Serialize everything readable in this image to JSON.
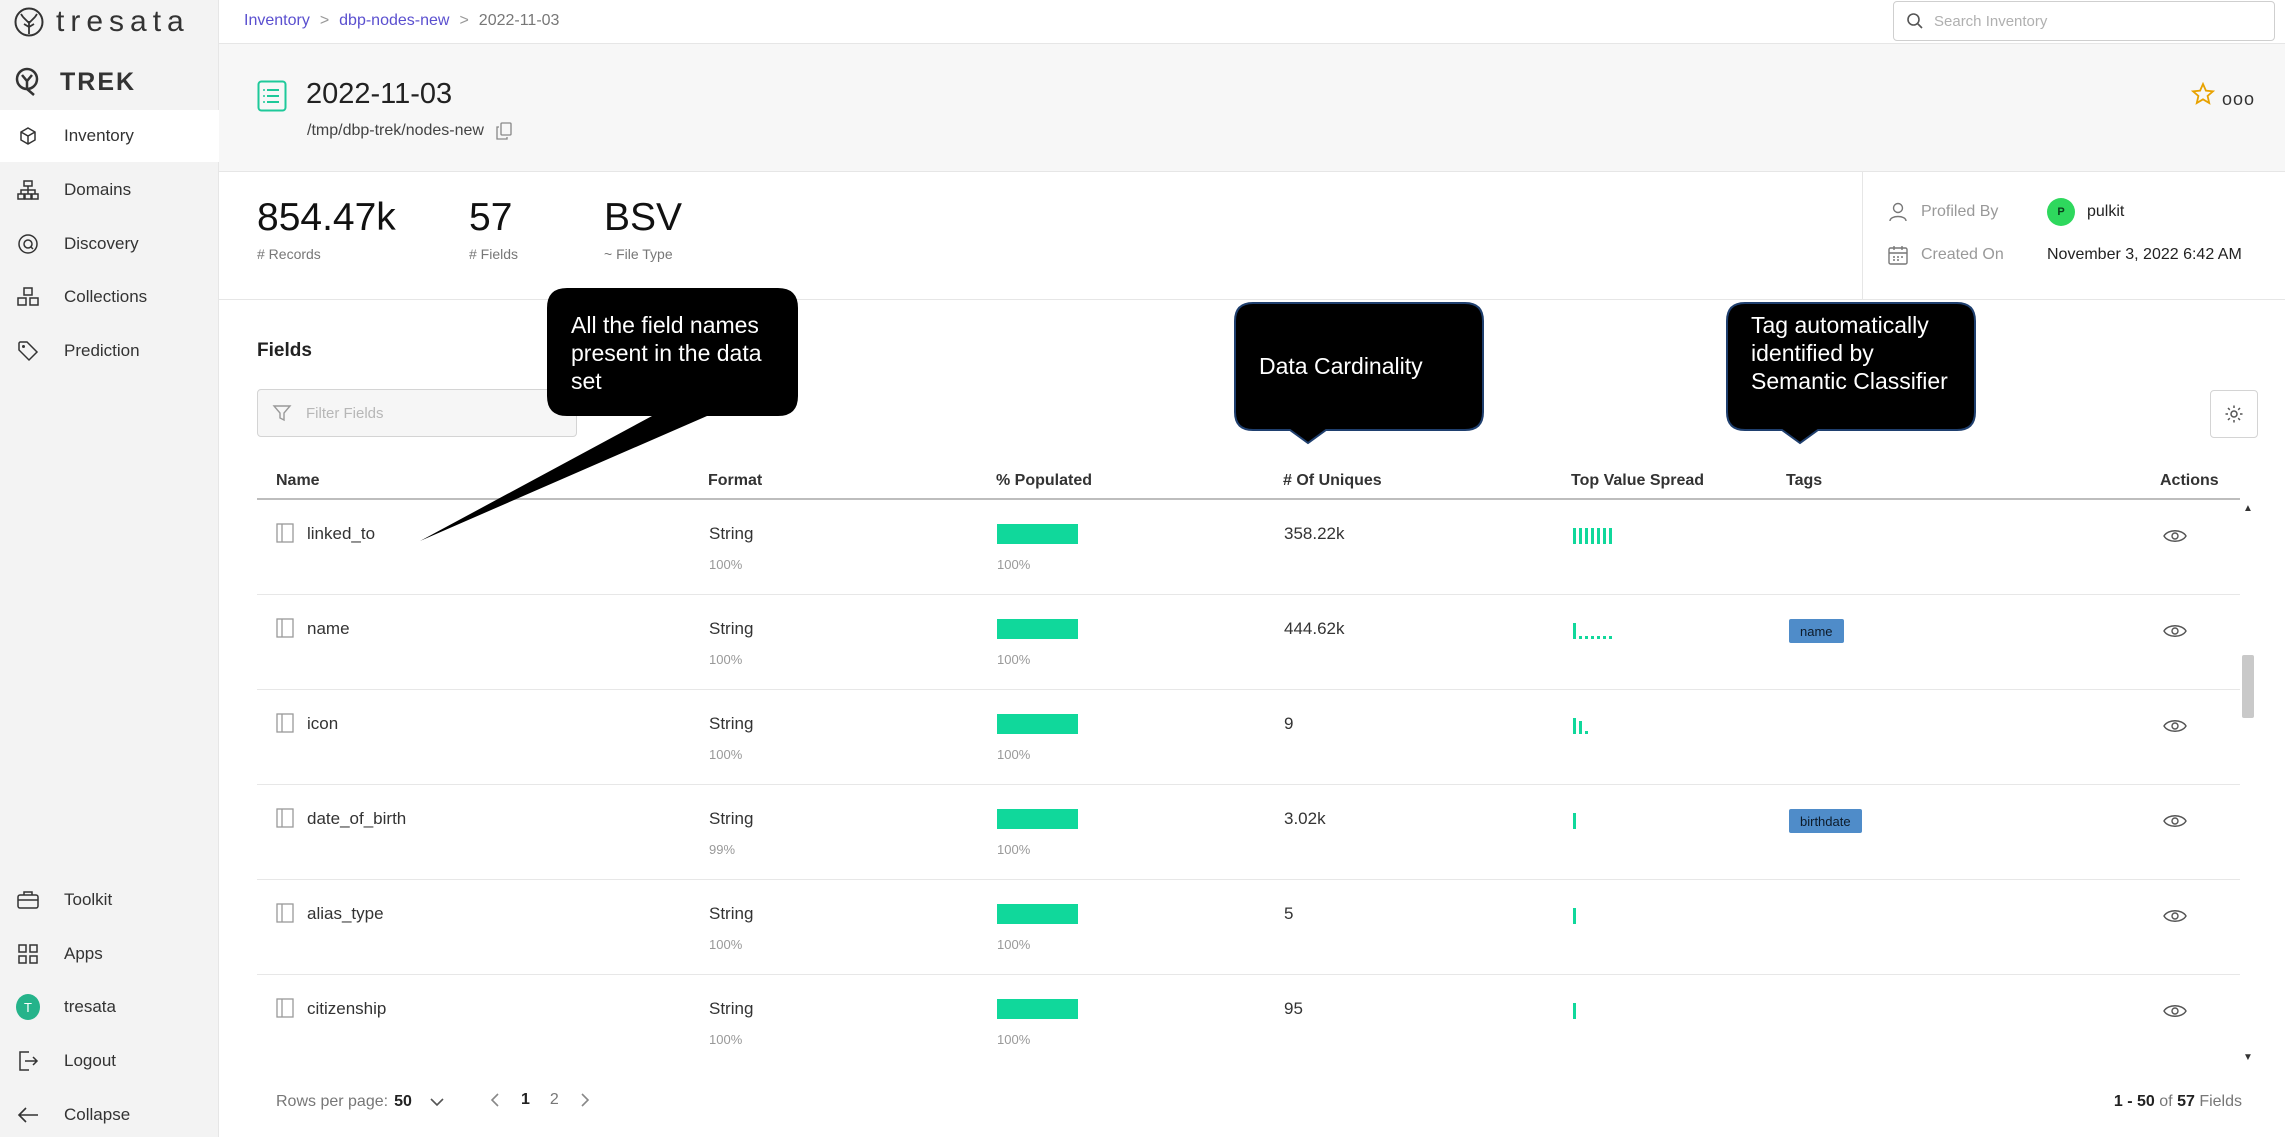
{
  "brand": {
    "name": "tresata",
    "product": "TREK"
  },
  "sidebar": {
    "items": [
      {
        "label": "Inventory",
        "icon": "cube-icon",
        "active": true
      },
      {
        "label": "Domains",
        "icon": "hierarchy-icon"
      },
      {
        "label": "Discovery",
        "icon": "discovery-icon"
      },
      {
        "label": "Collections",
        "icon": "cubes-icon"
      },
      {
        "label": "Prediction",
        "icon": "tag-icon"
      }
    ],
    "bottom": [
      {
        "label": "Toolkit",
        "icon": "briefcase-icon"
      },
      {
        "label": "Apps",
        "icon": "grid-icon"
      },
      {
        "label": "tresata",
        "icon": "user-avatar",
        "avatar_letter": "T"
      },
      {
        "label": "Logout",
        "icon": "logout-icon"
      },
      {
        "label": "Collapse",
        "icon": "arrow-left-icon"
      }
    ]
  },
  "breadcrumb": {
    "root": "Inventory",
    "folder": "dbp-nodes-new",
    "current": "2022-11-03"
  },
  "search": {
    "placeholder": "Search Inventory"
  },
  "dataset": {
    "title": "2022-11-03",
    "path": "/tmp/dbp-trek/nodes-new",
    "more": "ooo"
  },
  "stats": {
    "records": {
      "value": "854.47k",
      "label": "# Records"
    },
    "fields": {
      "value": "57",
      "label": "# Fields"
    },
    "file_type": {
      "value": "BSV",
      "label": "~ File Type"
    }
  },
  "meta": {
    "profiled_by_label": "Profiled By",
    "profiled_by_initial": "P",
    "profiled_by_value": "pulkit",
    "created_on_label": "Created On",
    "created_on_value": "November 3, 2022 6:42 AM"
  },
  "fields_section": {
    "title": "Fields",
    "filter_placeholder": "Filter Fields"
  },
  "table": {
    "columns": [
      "Name",
      "Format",
      "% Populated",
      "# Of Uniques",
      "Top Value Spread",
      "Tags",
      "Actions"
    ],
    "rows": [
      {
        "name": "linked_to",
        "format": "String",
        "format_pct": "100%",
        "populated": 1.0,
        "populated_label": "100%",
        "uniques": "358.22k",
        "spread": [
          1,
          1,
          1,
          1,
          1,
          1,
          1
        ],
        "tag": ""
      },
      {
        "name": "name",
        "format": "String",
        "format_pct": "100%",
        "populated": 1.0,
        "populated_label": "100%",
        "uniques": "444.62k",
        "spread": [
          1,
          0.2,
          0.2,
          0.2,
          0.2,
          0.2,
          0.2
        ],
        "tag": "name"
      },
      {
        "name": "icon",
        "format": "String",
        "format_pct": "100%",
        "populated": 1.0,
        "populated_label": "100%",
        "uniques": "9",
        "spread": [
          1,
          0.8,
          0.2
        ],
        "tag": ""
      },
      {
        "name": "date_of_birth",
        "format": "String",
        "format_pct": "99%",
        "populated": 1.0,
        "populated_label": "100%",
        "uniques": "3.02k",
        "spread": [
          1
        ],
        "tag": "birthdate"
      },
      {
        "name": "alias_type",
        "format": "String",
        "format_pct": "100%",
        "populated": 1.0,
        "populated_label": "100%",
        "uniques": "5",
        "spread": [
          1
        ],
        "tag": ""
      },
      {
        "name": "citizenship",
        "format": "String",
        "format_pct": "100%",
        "populated": 1.0,
        "populated_label": "100%",
        "uniques": "95",
        "spread": [
          1
        ],
        "tag": ""
      }
    ]
  },
  "pagination": {
    "rows_per_page_label": "Rows per page:",
    "rows_per_page": "50",
    "pages": [
      "1",
      "2"
    ],
    "current_page": "1",
    "range_text": "1 - 50",
    "of_text": "of",
    "total": "57",
    "unit": "Fields"
  },
  "callouts": [
    {
      "id": "field-names",
      "text": "All the field names present in the data set"
    },
    {
      "id": "cardinality",
      "text": "Data Cardinality"
    },
    {
      "id": "tags",
      "text": "Tag automatically identified by Semantic Classifier"
    }
  ],
  "colors": {
    "accent_green": "#10d89b",
    "tag_blue": "#4f8cc9",
    "link_purple": "#5a4fcf",
    "star": "#e8a200",
    "callout_bg": "#000000",
    "callout_border": "#1f3f6e"
  }
}
